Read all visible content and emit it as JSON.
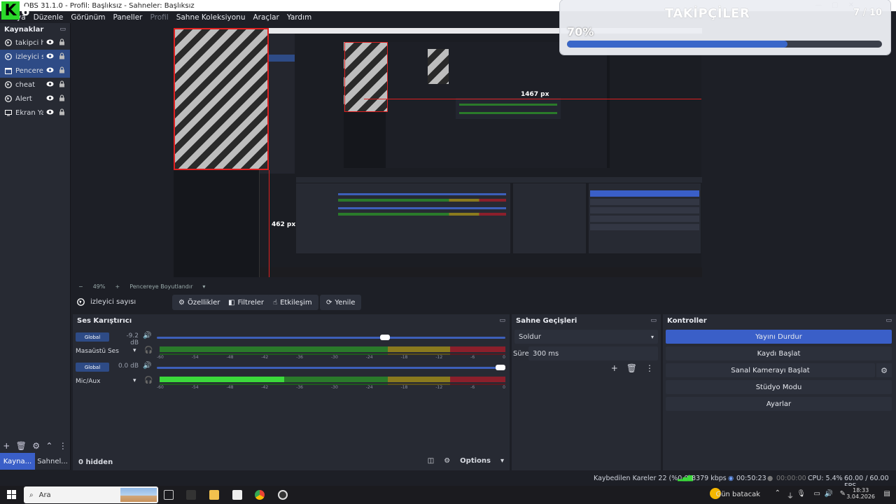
{
  "window": {
    "title": "OBS 31.1.0 - Profil: Başlıksız - Sahneler: Başlıksız",
    "min": "—",
    "max": "▢",
    "close": "✕"
  },
  "menu": [
    "Dosya",
    "Düzenle",
    "Görünüm",
    "Paneller",
    "Profil",
    "Sahne Koleksiyonu",
    "Araçlar",
    "Yardım"
  ],
  "logo": {
    "letter": "K",
    "digit": "6"
  },
  "sources": {
    "title": "Kaynaklar",
    "items": [
      {
        "label": "takipci hedef",
        "icon": "globe-icon"
      },
      {
        "label": "izleyici sayısı",
        "icon": "globe-icon"
      },
      {
        "label": "Pencere Yakalama",
        "icon": "window-icon"
      },
      {
        "label": "cheat",
        "icon": "globe-icon"
      },
      {
        "label": "Alert",
        "icon": "globe-icon"
      },
      {
        "label": "Ekran Yakalama",
        "icon": "monitor-icon"
      }
    ]
  },
  "dock_tabs": [
    "Kayna...",
    "Sahnel..."
  ],
  "widget": {
    "title": "TAKİPÇİLER",
    "count": "7 / 10",
    "percent": "70%",
    "progress": 0.7
  },
  "preview": {
    "label_width": "1467 px",
    "label_height": "462 px",
    "zoom": "49%",
    "zoom_mode": "Pencereye Boyutlandır"
  },
  "source_toolbar": {
    "selected_source": "izleyici sayısı",
    "buttons": [
      "Özellikler",
      "Filtreler",
      "Etkileşim",
      "Yenile"
    ]
  },
  "mixer": {
    "title": "Ses Karıştırıcı",
    "channels": [
      {
        "badge": "Global",
        "db": "-9.2 dB",
        "name": "Masaüstü Ses",
        "volume": 0.66
      },
      {
        "badge": "Global",
        "db": "0.0 dB",
        "name": "Mic/Aux",
        "volume": 1.0
      }
    ],
    "ticks": [
      "-60",
      "-54",
      "-48",
      "-42",
      "-36",
      "-30",
      "-24",
      "-18",
      "-12",
      "-6",
      "0"
    ],
    "hidden": "0 hidden",
    "options": "Options"
  },
  "transitions": {
    "title": "Sahne Geçişleri",
    "selected": "Soldur",
    "duration_label": "Süre",
    "duration_value": "300 ms"
  },
  "controls": {
    "title": "Kontroller",
    "buttons": [
      "Yayını Durdur",
      "Kaydı Başlat",
      "Sanal Kamerayı Başlat",
      "Stüdyo Modu",
      "Ayarlar"
    ]
  },
  "status": {
    "dropped": "Kaybedilen Kareler 22 (%0.0)",
    "bitrate": "8379 kbps",
    "stream_time": "00:50:23",
    "record_time": "00:00:00",
    "cpu": "CPU: 5.4%",
    "fps": "60.00 / 60.00 FPS"
  },
  "taskbar": {
    "search": "Ara",
    "weather": "Gün batacak",
    "time": "18:33",
    "date": "3.04.2026"
  },
  "colors": {
    "accent": "#3a5fc8",
    "selection": "#2e4b86",
    "panel": "#272a33",
    "background": "#1d1f26"
  }
}
